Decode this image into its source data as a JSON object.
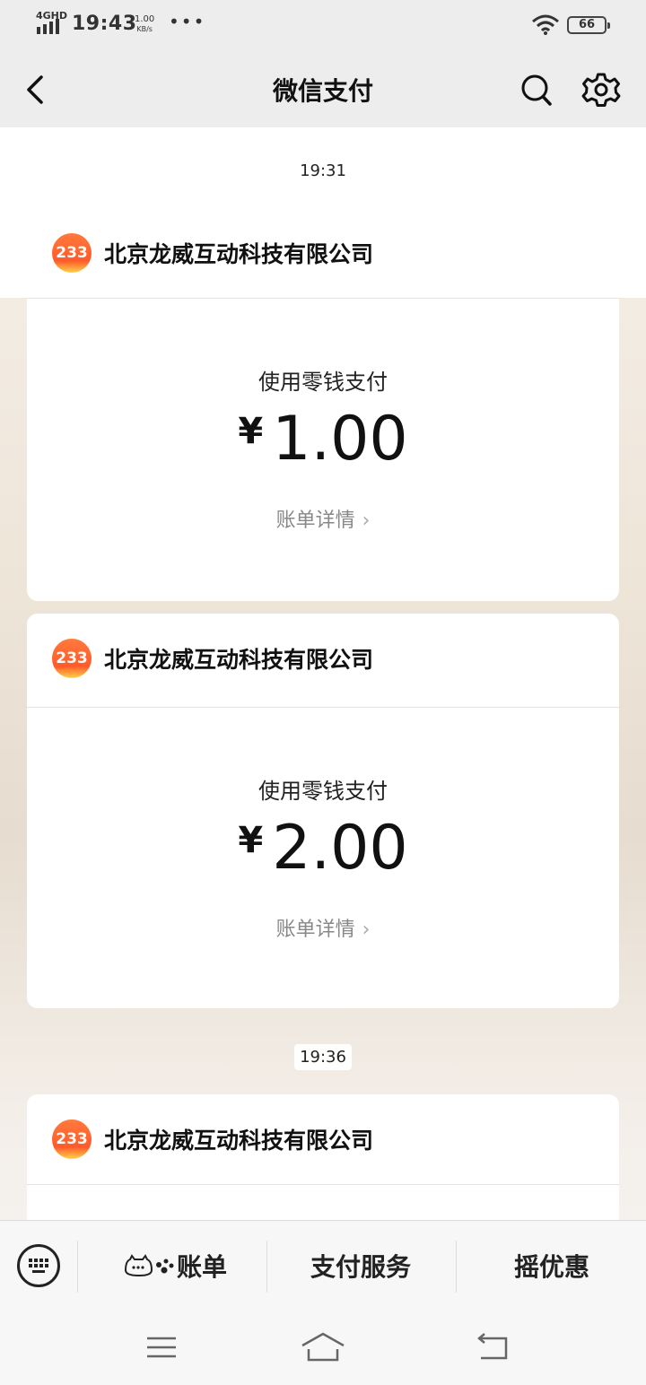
{
  "status_bar": {
    "network": "4GHD",
    "time": "19:43",
    "speed_value": "1.00",
    "speed_unit": "KB/s",
    "dots": "•••",
    "battery": "66"
  },
  "nav": {
    "title": "微信支付",
    "back_icon": "chevron-left-icon",
    "search_icon": "search-icon",
    "settings_icon": "gear-icon"
  },
  "messages": [
    {
      "time": "19:31",
      "merchant_logo_text": "233",
      "merchant_name": "北京龙威互动科技有限公司",
      "pay_method": "使用零钱支付",
      "currency": "¥",
      "amount": "1.00",
      "detail_label": "账单详情"
    },
    {
      "merchant_logo_text": "233",
      "merchant_name": "北京龙威互动科技有限公司",
      "pay_method": "使用零钱支付",
      "currency": "¥",
      "amount": "2.00",
      "detail_label": "账单详情"
    },
    {
      "time": "19:36",
      "merchant_logo_text": "233",
      "merchant_name": "北京龙威互动科技有限公司"
    }
  ],
  "bottom_menu": {
    "keyboard_icon": "keyboard-icon",
    "items": [
      {
        "label": "账单"
      },
      {
        "label": "支付服务"
      },
      {
        "label": "摇优惠"
      }
    ]
  },
  "system_nav": {
    "menu_icon": "menu-icon",
    "home_icon": "home-icon",
    "back_icon": "back-arrow-icon"
  },
  "colors": {
    "bar_bg": "#ededed",
    "logo_orange": "#ff5b2a",
    "text_gray": "#888888"
  }
}
